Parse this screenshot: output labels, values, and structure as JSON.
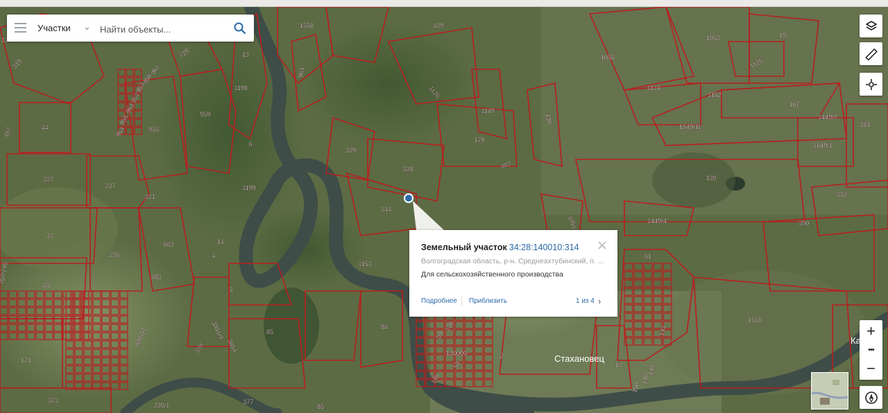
{
  "colors": {
    "parcel_line": "#b81f1f",
    "label_text": "#ffffff",
    "link": "#2b6aa8"
  },
  "search": {
    "category": "Участки",
    "placeholder": "Найти объекты..."
  },
  "toolbar": {
    "layers_icon": "layers-icon",
    "ruler_icon": "ruler-icon",
    "locate_icon": "crosshair-icon",
    "zoom_in": "+",
    "zoom_more": "•••",
    "zoom_out": "−",
    "compass_icon": "compass-icon"
  },
  "popup": {
    "title": "Земельный участок",
    "cadastral_number": "34:28:140010:314",
    "address": "Волгоградская область, р-н. Среднеахтубинский, п. ...",
    "usage": "Для сельскохозяйственного производства",
    "details_link": "Подробнее",
    "zoom_link": "Приблизить",
    "pagination": "1 из 4"
  },
  "places": [
    {
      "id": "stakhanovets",
      "label": "Стахановец"
    },
    {
      "id": "ka",
      "label": "Ка"
    }
  ],
  "parcel_labels": [
    {
      "id": "p-1558",
      "label": "1558"
    },
    {
      "id": "p-429",
      "label": "429"
    },
    {
      "id": "p-1053",
      "label": "1053"
    },
    {
      "id": "p-19",
      "label": "19"
    },
    {
      "id": "p-1056",
      "label": "1056"
    },
    {
      "id": "p-1125",
      "label": "1125"
    },
    {
      "id": "p-1124",
      "label": "1124"
    },
    {
      "id": "p-1152",
      "label": "1152"
    },
    {
      "id": "p-107",
      "label": "107"
    },
    {
      "id": "p-1449-2",
      "label": "1449/2"
    },
    {
      "id": "p-181",
      "label": "181"
    },
    {
      "id": "p-1649-11",
      "label": "1649/11"
    },
    {
      "id": "p-1649-1",
      "label": "1649/1"
    },
    {
      "id": "p-139-r",
      "label": "139"
    },
    {
      "id": "p-139",
      "label": "139"
    },
    {
      "id": "p-1149",
      "label": "1149"
    },
    {
      "id": "p-1126",
      "label": "1126"
    },
    {
      "id": "p-170",
      "label": "170"
    },
    {
      "id": "p-482",
      "label": "482"
    },
    {
      "id": "p-329",
      "label": "329"
    },
    {
      "id": "p-328",
      "label": "328"
    },
    {
      "id": "p-314",
      "label": "314"
    },
    {
      "id": "p-1051",
      "label": "1051"
    },
    {
      "id": "p-1449-4",
      "label": "1449/4"
    },
    {
      "id": "p-332",
      "label": "332"
    },
    {
      "id": "p-390",
      "label": "390"
    },
    {
      "id": "p-61",
      "label": "61"
    },
    {
      "id": "p-1559",
      "label": "1559"
    },
    {
      "id": "p-143",
      "label": "143"
    },
    {
      "id": "p-14",
      "label": "14"
    },
    {
      "id": "p-150",
      "label": "150"
    },
    {
      "id": "p-149",
      "label": "149"
    },
    {
      "id": "p-148",
      "label": "148"
    },
    {
      "id": "p-84",
      "label": "84"
    },
    {
      "id": "p-126",
      "label": "126"
    },
    {
      "id": "p-59",
      "label": "59"
    },
    {
      "id": "p-140009",
      "label": "140009"
    },
    {
      "id": "p-2",
      "label": "2"
    },
    {
      "id": "p-58",
      "label": "58"
    },
    {
      "id": "p-146",
      "label": "146"
    },
    {
      "id": "p-1153",
      "label": "1153"
    },
    {
      "id": "p-85",
      "label": "85"
    },
    {
      "id": "p-85-b",
      "label": "85"
    },
    {
      "id": "p-377",
      "label": "377"
    },
    {
      "id": "p-220-1",
      "label": "220/1"
    },
    {
      "id": "p-3851-4",
      "label": "3851/4"
    },
    {
      "id": "p-3854",
      "label": "3854"
    },
    {
      "id": "p-378",
      "label": "378"
    },
    {
      "id": "p-5",
      "label": "5"
    },
    {
      "id": "p-4",
      "label": "4"
    },
    {
      "id": "p-14-l",
      "label": "14"
    },
    {
      "id": "p-663",
      "label": "663"
    },
    {
      "id": "p-483",
      "label": "483"
    },
    {
      "id": "p-226",
      "label": "226"
    },
    {
      "id": "p-47",
      "label": "47"
    },
    {
      "id": "p-45",
      "label": "45"
    },
    {
      "id": "p-171",
      "label": "171"
    },
    {
      "id": "p-373",
      "label": "373"
    },
    {
      "id": "p-641",
      "label": "641"
    },
    {
      "id": "p-640",
      "label": "640"
    },
    {
      "id": "p-321",
      "label": "321"
    },
    {
      "id": "p-237",
      "label": "237"
    },
    {
      "id": "p-227",
      "label": "227"
    },
    {
      "id": "p-44",
      "label": "44"
    },
    {
      "id": "p-1199",
      "label": "1199"
    },
    {
      "id": "p-6",
      "label": "6"
    },
    {
      "id": "p-959",
      "label": "959"
    },
    {
      "id": "p-955",
      "label": "955"
    },
    {
      "id": "p-1198",
      "label": "1198"
    },
    {
      "id": "p-13",
      "label": "13"
    },
    {
      "id": "p-728",
      "label": "728"
    },
    {
      "id": "p-961",
      "label": "961"
    },
    {
      "id": "p-956",
      "label": "956"
    },
    {
      "id": "p-953",
      "label": "953"
    },
    {
      "id": "p-957",
      "label": "957"
    },
    {
      "id": "p-963",
      "label": "963"
    },
    {
      "id": "p-958",
      "label": "958"
    },
    {
      "id": "p-954",
      "label": "954"
    },
    {
      "id": "p-961-t",
      "label": "961"
    },
    {
      "id": "p-319",
      "label": "319"
    },
    {
      "id": "p-32",
      "label": "32"
    },
    {
      "id": "p-487",
      "label": "487"
    },
    {
      "id": "p-757-740",
      "label": "757/740"
    }
  ]
}
